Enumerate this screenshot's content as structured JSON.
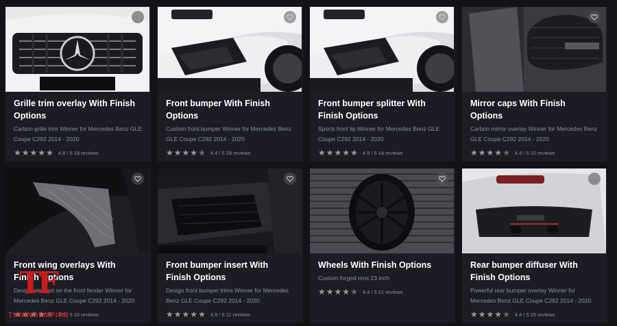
{
  "products": [
    {
      "title": "Grille trim overlay With Finish Options",
      "desc": "Carbon grille trim Winner for Mercedes Benz GLE Coupe C292 2014 - 2020",
      "rating": 4.8,
      "rating_text": "4.8 / 5 18 reviews",
      "image": "grille-photo",
      "wish_style": "solid"
    },
    {
      "title": "Front bumper With Finish Options",
      "desc": "Custom front bumper Winner for Mercedes Benz GLE Coupe C292 2014 - 2020",
      "rating": 4.4,
      "rating_text": "4.4 / 5 29 reviews",
      "image": "front-bumper-photo",
      "wish_style": "outline"
    },
    {
      "title": "Front bumper splitter With Finish Options",
      "desc": "Sports front lip Winner for Mercedes Benz GLE Coupe C292 2014 - 2020",
      "rating": 4.9,
      "rating_text": "4.9 / 5 14 reviews",
      "image": "splitter-photo",
      "wish_style": "outline"
    },
    {
      "title": "Mirror caps With Finish Options",
      "desc": "Carbon mirror overlay Winner for Mercedes Benz GLE Coupe C292 2014 - 2020",
      "rating": 4.4,
      "rating_text": "4.4 / 5 10 reviews",
      "image": "mirror-photo",
      "wish_style": "outline"
    },
    {
      "title": "Front wing overlays With Finish Options",
      "desc": "Design element on the front fender Winner for Mercedes Benz GLE Coupe C292 2014 - 2020",
      "rating": 4.5,
      "rating_text": "4.5 / 5 18 reviews",
      "image": "wing-photo",
      "wish_style": "outline"
    },
    {
      "title": "Front bumper insert With Finish Options",
      "desc": "Design front bumper trims Winner for Mercedes Benz GLE Coupe C292 2014 - 2020",
      "rating": 4.9,
      "rating_text": "4.9 / 5 11 reviews",
      "image": "insert-photo",
      "wish_style": "outline"
    },
    {
      "title": "Wheels With Finish Options",
      "desc": "Custom forged rims 23 inch",
      "rating": 4.4,
      "rating_text": "4.4 / 5 21 reviews",
      "image": "wheel-photo",
      "wish_style": "outline"
    },
    {
      "title": "Rear bumper diffuser With Finish Options",
      "desc": "Powerful rear bumper overlay Winner for Mercedes Benz GLE Coupe C292 2014 - 2020",
      "rating": 4.4,
      "rating_text": "4.4 / 5 25 reviews",
      "image": "diffuser-photo",
      "wish_style": "solid"
    }
  ],
  "watermark": {
    "mark": "TF",
    "name": "TUNINGEMPIRE",
    "color": "#c81d1d"
  },
  "colors": {
    "background": "#121318",
    "card": "#1c1d24",
    "text": "#ffffff",
    "muted": "#8e9099",
    "star": "#9c9c9c"
  }
}
